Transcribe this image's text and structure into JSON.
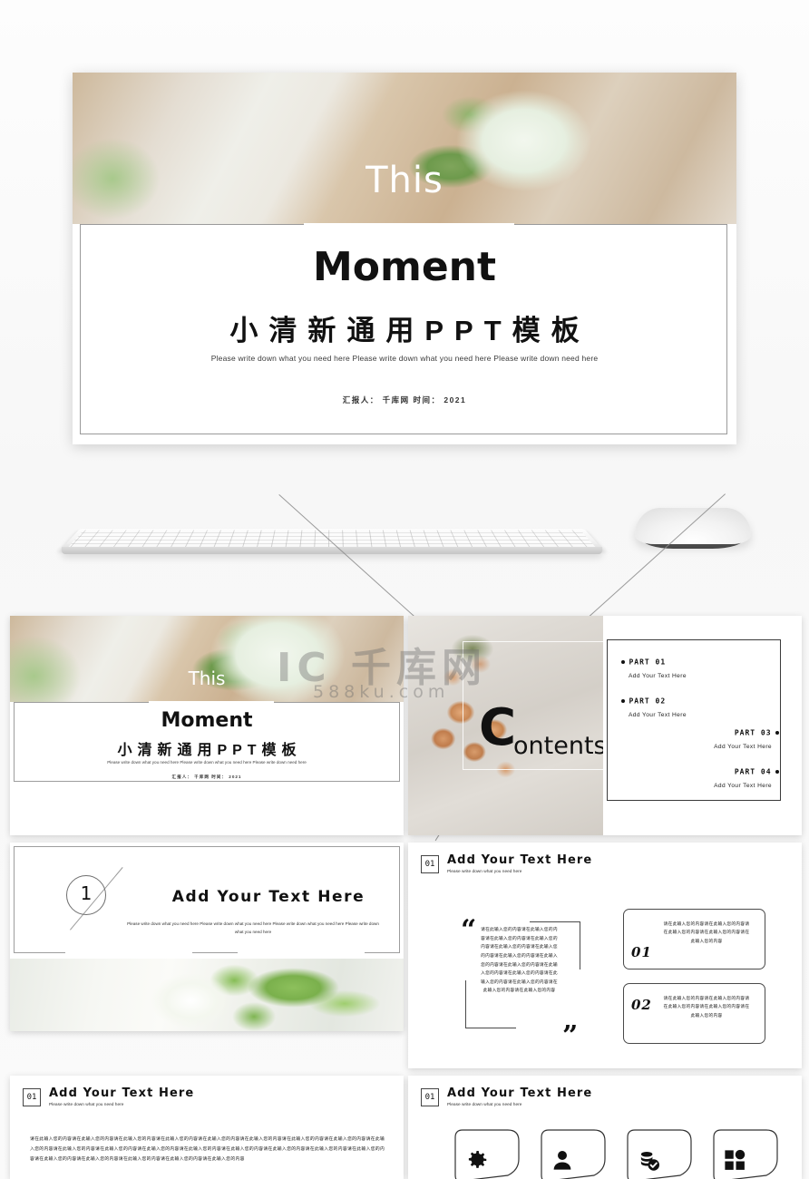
{
  "hero": {
    "eyebrow": "This",
    "title": "Moment",
    "title_cn": "小清新通用PPT模板",
    "subtitle": "Please write down what you need here Please write down what you need here Please write down need here",
    "meta": "汇报人： 千库网      时间： 2021"
  },
  "watermark": {
    "main": "IC 千库网",
    "sub": "588ku.com"
  },
  "thumbnails": {
    "title_slide": {
      "eyebrow": "This",
      "title": "Moment",
      "title_cn": "小清新通用PPT模板",
      "subtitle": "Please write down what you need here Please write down what you need here Please write down need here",
      "meta": "汇报人： 千库网      时间： 2021"
    },
    "contents_slide": {
      "heading_letter": "C",
      "heading_rest": "ontents",
      "items": [
        {
          "part": "PART 01",
          "desc": "Add Your Text Here",
          "align": "left"
        },
        {
          "part": "PART 02",
          "desc": "Add Your Text Here",
          "align": "left"
        },
        {
          "part": "PART 03",
          "desc": "Add Your Text Here",
          "align": "right"
        },
        {
          "part": "PART 04",
          "desc": "Add Your Text Here",
          "align": "right"
        }
      ]
    },
    "section_slide": {
      "number": "1",
      "title": "Add Your Text Here",
      "body": "Please write down what you need here Please write down what you need here Please write down what you need here Please write down what you need here"
    },
    "quote_slide": {
      "number": "01",
      "title": "Add Your Text Here",
      "subtitle": "Please write down what you need here",
      "quote_open": "“",
      "quote_close": "”",
      "quote_text": "请在此输入您的内容请在此输入您的内容请在此输入您的内容请在此输入您的内容请在此输入您的内容请在此输入您的内容请在此输入您的内容请在此输入您的内容请在此输入您的内容请在此输入您的内容请在此输入您的内容请在此输入您的内容请在此输入您的内容请在此输入您的内容请在此输入您的内容",
      "cards": [
        {
          "num": "01",
          "text": "请在此输入您的内容请在此输入您的内容请在此输入您的内容请在此输入您的内容请在此输入您的内容"
        },
        {
          "num": "02",
          "text": "请在此输入您的内容请在此输入您的内容请在此输入您的内容请在此输入您的内容请在此输入您的内容"
        }
      ]
    },
    "paragraph_slide": {
      "number": "01",
      "title": "Add Your Text Here",
      "subtitle": "Please write down what you need here",
      "body": "请在此输入您的内容请在此输入您的内容请在此输入您的内容请在此输入您的内容请在此输入您的内容请在此输入您的内容请在此输入您的内容请在此输入您的内容请在此输入您的内容请在此输入您的内容请在此输入您的内容请在此输入您的内容请在此输入您的内容请在此输入您的内容请在此输入您的内容请在此输入您的内容请在此输入您的内容请在此输入您的内容请在此输入您的内容请在此输入您的内容请在此输入您的内容请在此输入您的内容"
    },
    "icons_slide": {
      "number": "01",
      "title": "Add Your Text Here",
      "subtitle": "Please write down what you need here",
      "icons": [
        {
          "name": "gear-icon"
        },
        {
          "name": "person-icon"
        },
        {
          "name": "coins-check-icon"
        },
        {
          "name": "grid-icon"
        }
      ]
    }
  },
  "colors": {
    "ink": "#111111",
    "frame": "#9a9a9a",
    "card_border": "#4a4a4a",
    "page_bg": "#fafafa"
  }
}
